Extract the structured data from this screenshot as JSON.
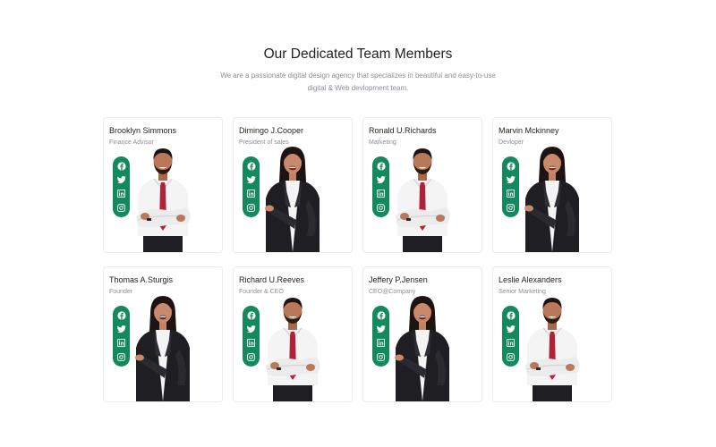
{
  "section": {
    "title": "Our Dedicated Team Members",
    "subtitle": "We are a passionate digital design agency that specializes in beautiful and easy-to-use digital & Web devlopment team."
  },
  "colors": {
    "accent": "#128a5c",
    "tie": "#b0213a",
    "suit": "#1f1f23",
    "skin": "#b9785a",
    "hair": "#1c1412"
  },
  "social_icons": [
    "facebook-icon",
    "twitter-icon",
    "linkedin-icon",
    "instagram-icon"
  ],
  "members": [
    {
      "name": "Brooklyn Simmons",
      "role": "Finance Advisor"
    },
    {
      "name": "Dimingo J.Cooper",
      "role": "President of sales"
    },
    {
      "name": "Ronald U.Richards",
      "role": "Marketing"
    },
    {
      "name": "Marvin Mckinney",
      "role": "Devloper"
    },
    {
      "name": "Thomas A.Sturgis",
      "role": "Founder"
    },
    {
      "name": "Richard U.Reeves",
      "role": "Founder & CEO"
    },
    {
      "name": "Jeffery P.Jensen",
      "role": "CEO@Company"
    },
    {
      "name": "Leslie Alexanders",
      "role": "Senior Marketing"
    }
  ]
}
